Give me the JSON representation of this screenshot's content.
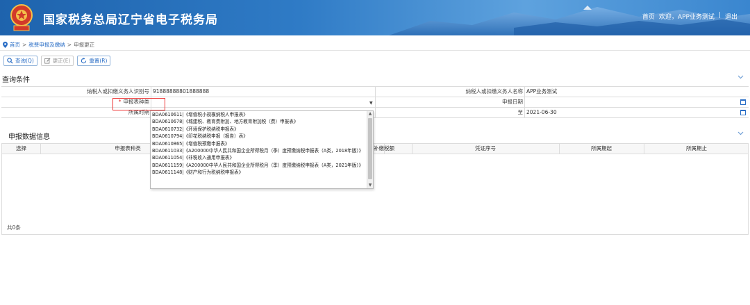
{
  "header": {
    "title": "国家税务总局辽宁省电子税务局",
    "links": {
      "home": "首页",
      "welcome": "欢迎，APP业务测试",
      "separator": "|",
      "logout": "退出"
    },
    "colors": {
      "banner": "#2f7bc6"
    }
  },
  "breadcrumb": {
    "home": "首页",
    "sep": ">",
    "level1": "税费申报及缴纳",
    "current": "申报更正"
  },
  "toolbar": {
    "query": {
      "label": "查询(Q)",
      "icon": "search-icon"
    },
    "correct": {
      "label": "更正(E)",
      "icon": "edit-icon"
    },
    "reset": {
      "label": "重置(R)",
      "icon": "refresh-icon"
    }
  },
  "query_section": {
    "title": "查询条件",
    "taxpayer_id_label": "纳税人或扣缴义务人识别号",
    "taxpayer_id_value": "91888888801888888",
    "taxpayer_name_label": "纳税人或扣缴义务人名称",
    "taxpayer_name_value": "APP业务测试",
    "report_type_label": "申报表种类",
    "report_type_value": "",
    "report_date_label": "申报日期",
    "period_label": "所属时期",
    "period_to_label": "至",
    "period_to_value": "2021-06-30"
  },
  "dropdown": {
    "options": [
      "BDA0610611|《增值税小规模纳税人申报表》",
      "BDA0610678|《城建税、教育费附加、地方教育附加税（费）申报表》",
      "BDA0610732|《环境保护税纳税申报表》",
      "BDA0610794|《印花税纳税申报（报告）表》",
      "BDA0610865|《增值税预缴申报表》",
      "BDA0611033|《A200000中华人民共和国企业所得税月（季）度预缴纳税申报表（A类，2018年版）》",
      "BDA0611054|《非税收入通用申报表》",
      "BDA0611159|《A200000中华人民共和国企业所得税月（季）度预缴纳税申报表（A类，2021年版）》",
      "BDA0611148|《财产和行为税纳税申报表》"
    ]
  },
  "data_section": {
    "title": "申报数据信息",
    "columns": [
      "选择",
      "申报表种类",
      "补缴税额",
      "凭证序号",
      "所属期起",
      "所属期止"
    ],
    "total": "共0条"
  }
}
